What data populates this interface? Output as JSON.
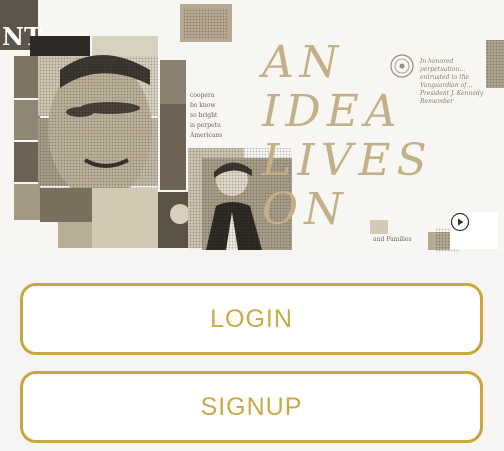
{
  "hero": {
    "headline_lines": [
      "AN",
      "IDEA",
      "LIVES",
      "ON"
    ],
    "corner_clip_text": "NT",
    "seal_caption": "In honored perpetuation… entrusted to the Vanguardian of… President J. Kennedy Remember",
    "side_text_lines": [
      "coopera",
      "be know",
      "so bright",
      "is perpetu",
      "Americans"
    ],
    "bottom_caption": "and Families",
    "accent_color": "#c2b088",
    "play_icon": "play-circle-icon"
  },
  "actions": {
    "login_label": "LOGIN",
    "signup_label": "SIGNUP",
    "button_color": "#c6a83c"
  }
}
